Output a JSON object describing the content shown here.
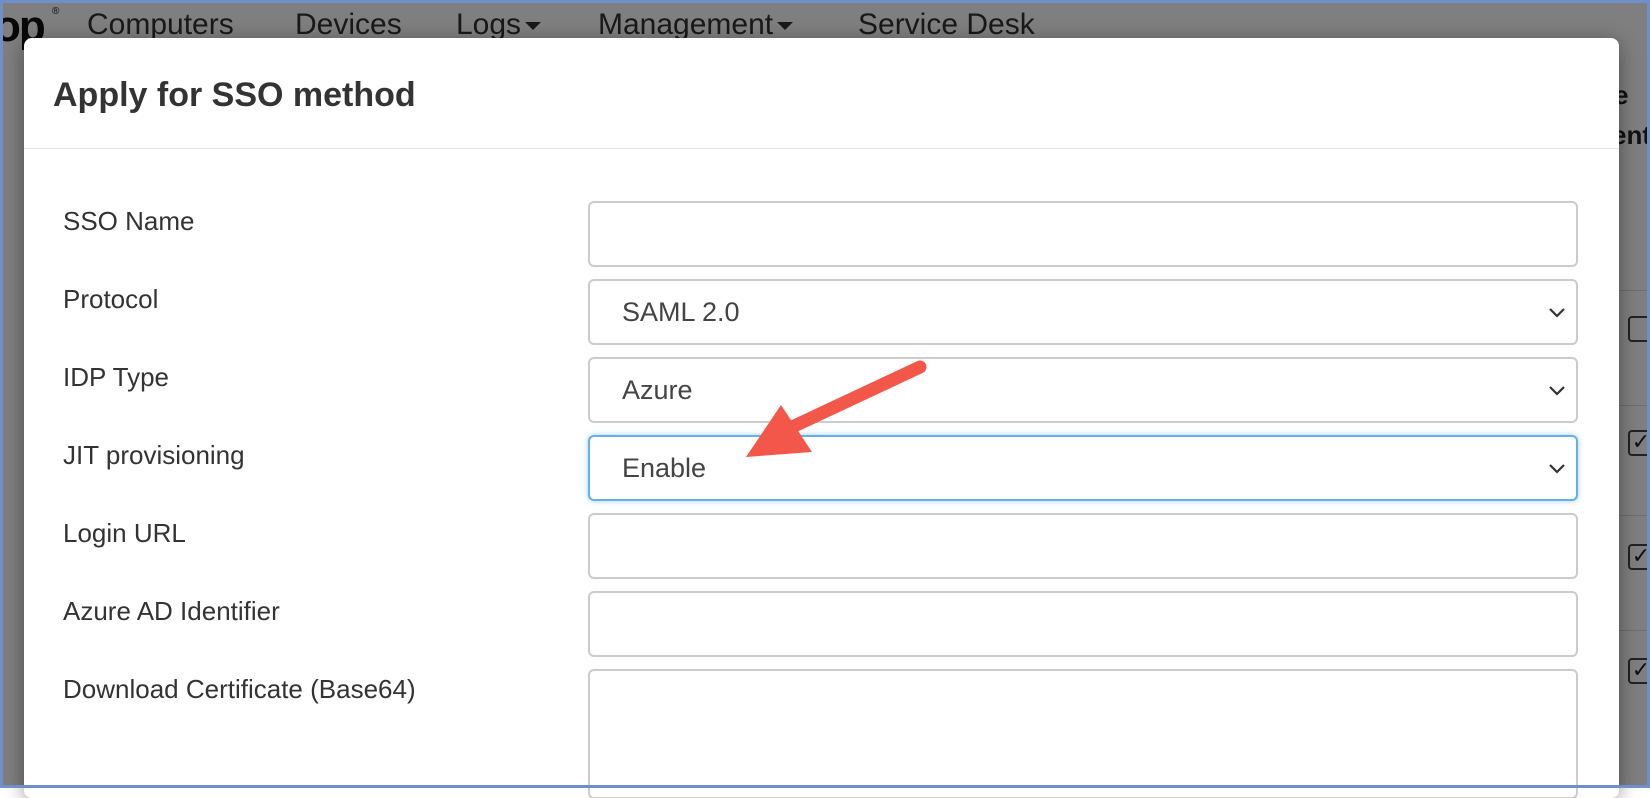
{
  "background": {
    "logo_text": "op",
    "logo_mark": "®",
    "nav": [
      {
        "label": "Computers",
        "has_caret": false
      },
      {
        "label": "Devices",
        "has_caret": false
      },
      {
        "label": "Logs",
        "has_caret": true
      },
      {
        "label": "Management",
        "has_caret": true
      },
      {
        "label": "Service Desk",
        "has_caret": false
      }
    ],
    "right_header_line1": "e",
    "right_header_line2": "ent"
  },
  "modal": {
    "title": "Apply for SSO method",
    "fields": {
      "sso_name": {
        "label": "SSO Name",
        "value": ""
      },
      "protocol": {
        "label": "Protocol",
        "value": "SAML 2.0"
      },
      "idp_type": {
        "label": "IDP Type",
        "value": "Azure"
      },
      "jit_provisioning": {
        "label": "JIT provisioning",
        "value": "Enable"
      },
      "login_url": {
        "label": "Login URL",
        "value": ""
      },
      "azure_ad_identifier": {
        "label": "Azure AD Identifier",
        "value": ""
      },
      "download_certificate": {
        "label": "Download Certificate (Base64)",
        "value": ""
      }
    }
  },
  "colors": {
    "annotation_arrow": "#f2574a",
    "focus_border": "#66afe9",
    "frame_border": "#6f8fc8"
  },
  "icons": {
    "select_chevron": "chevron-down-icon",
    "annotation": "red-arrow-icon"
  }
}
